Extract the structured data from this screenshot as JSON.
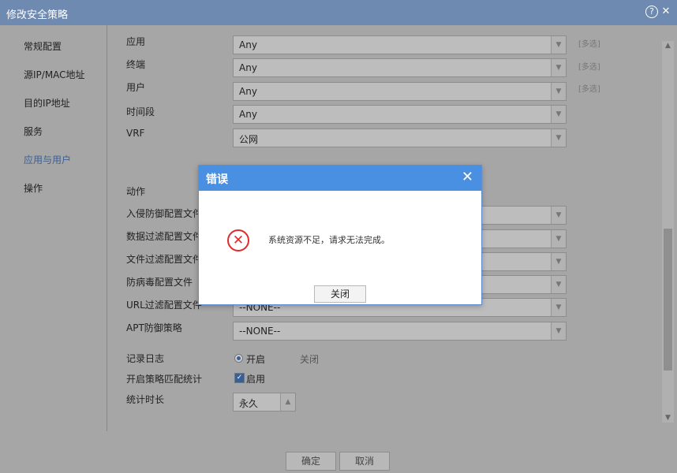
{
  "window": {
    "title": "修改安全策略"
  },
  "sidebar": {
    "items": [
      {
        "label": "常规配置"
      },
      {
        "label": "源IP/MAC地址"
      },
      {
        "label": "目的IP地址"
      },
      {
        "label": "服务"
      },
      {
        "label": "应用与用户"
      },
      {
        "label": "操作"
      }
    ]
  },
  "form": {
    "application": {
      "label": "应用",
      "value": "Any",
      "hint": "[多选]"
    },
    "terminal": {
      "label": "终端",
      "value": "Any",
      "hint": "[多选]"
    },
    "user": {
      "label": "用户",
      "value": "Any",
      "hint": "[多选]"
    },
    "time_period": {
      "label": "时间段",
      "value": "Any"
    },
    "vrf": {
      "label": "VRF",
      "value": "公网"
    },
    "action": {
      "label": "动作"
    },
    "ips_profile": {
      "label": "入侵防御配置文件"
    },
    "data_filter_profile": {
      "label": "数据过滤配置文件"
    },
    "file_filter_profile": {
      "label": "文件过滤配置文件"
    },
    "antivirus_profile": {
      "label": "防病毒配置文件"
    },
    "url_filter_profile": {
      "label": "URL过滤配置文件",
      "value": "--NONE--"
    },
    "apt_policy": {
      "label": "APT防御策略",
      "value": "--NONE--"
    },
    "logging": {
      "label": "记录日志",
      "on": "开启",
      "off": "关闭"
    },
    "match_stats": {
      "label": "开启策略匹配统计",
      "checkbox": "启用"
    },
    "stats_duration": {
      "label": "统计时长",
      "value": "永久"
    }
  },
  "footer": {
    "ok_label": "确定",
    "cancel_label": "取消"
  },
  "dialog": {
    "title": "错误",
    "message": "系统资源不足，请求无法完成。",
    "close_button": "关闭"
  }
}
